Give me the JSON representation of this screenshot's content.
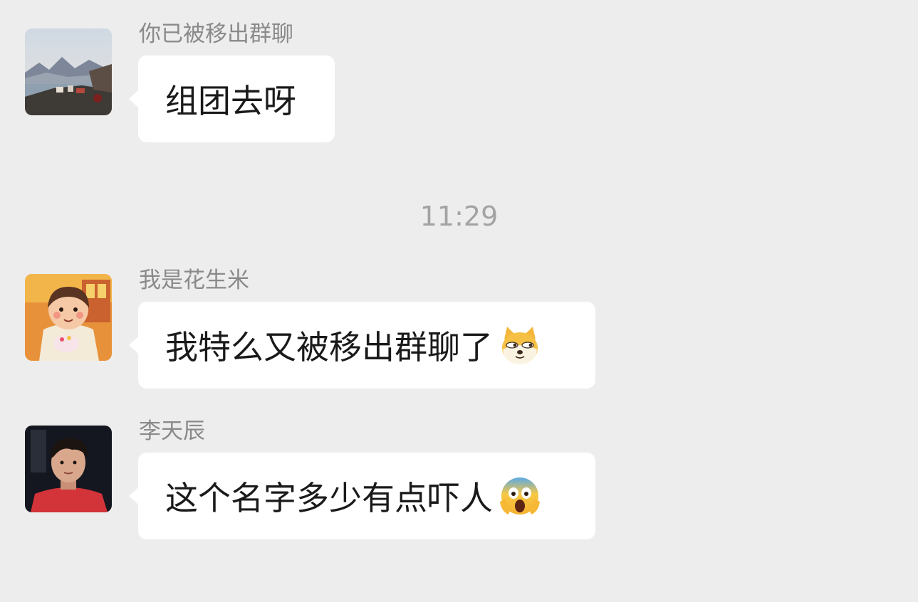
{
  "messages": [
    {
      "sender": "你已被移出群聊",
      "text": "组团去呀",
      "avatar_icon": "landscape-avatar-icon"
    },
    {
      "sender": "我是花生米",
      "text": "我特么又被移出群聊了",
      "emoji_icon": "sly-dog-emoji-icon",
      "avatar_icon": "illustrated-girl-avatar-icon"
    },
    {
      "sender": "李天辰",
      "text": "这个名字多少有点吓人",
      "emoji_icon": "screaming-face-emoji-icon",
      "avatar_icon": "boy-portrait-avatar-icon"
    }
  ],
  "timestamp": "11:29",
  "colors": {
    "background": "#ededed",
    "bubble": "#ffffff",
    "sender_text": "#8a8a8a",
    "timestamp_text": "#a3a3a3",
    "message_text": "#1a1a1a"
  }
}
